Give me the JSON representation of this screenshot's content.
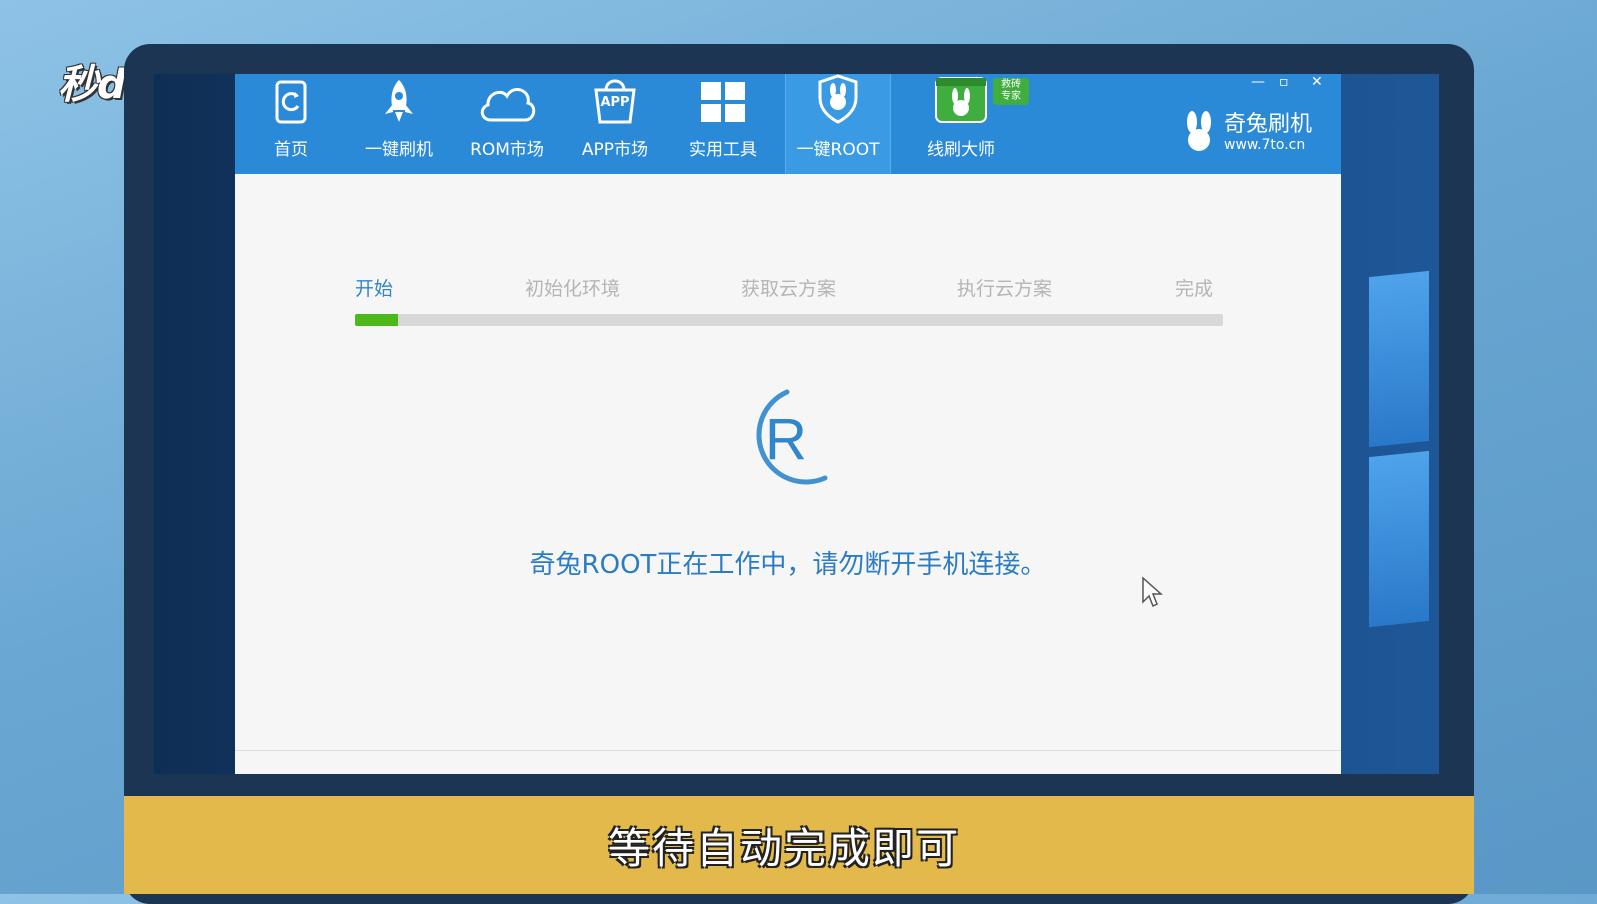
{
  "watermark": "秒dong视频",
  "toolbar": {
    "items": [
      {
        "label": "首页",
        "icon": "phone-refresh-icon"
      },
      {
        "label": "一键刷机",
        "icon": "rocket-icon"
      },
      {
        "label": "ROM市场",
        "icon": "cloud-icon"
      },
      {
        "label": "APP市场",
        "icon": "shopping-bag-icon"
      },
      {
        "label": "实用工具",
        "icon": "grid-icon"
      },
      {
        "label": "一键ROOT",
        "icon": "shield-rabbit-icon"
      },
      {
        "label": "线刷大师",
        "icon": "rabbit-box-icon"
      }
    ],
    "icon_app_text": "APP",
    "active_index": 5,
    "badge": "救砖\n专家",
    "brand_name": "奇兔刷机",
    "brand_url": "www.7to.cn",
    "colors": {
      "bar": "#2a8ad8",
      "active": "#3b9ae4"
    }
  },
  "steps": {
    "labels": [
      "开始",
      "初始化环境",
      "获取云方案",
      "执行云方案",
      "完成"
    ],
    "active_index": 0,
    "progress_fraction": 0.05
  },
  "spinner_letter": "R",
  "status_message": "奇兔ROOT正在工作中，请勿断开手机连接。",
  "subtitle": "等待自动完成即可",
  "colors": {
    "accent": "#2f86cc",
    "progress": "#4cb81c",
    "subtitle_bar": "#e2b94a"
  }
}
